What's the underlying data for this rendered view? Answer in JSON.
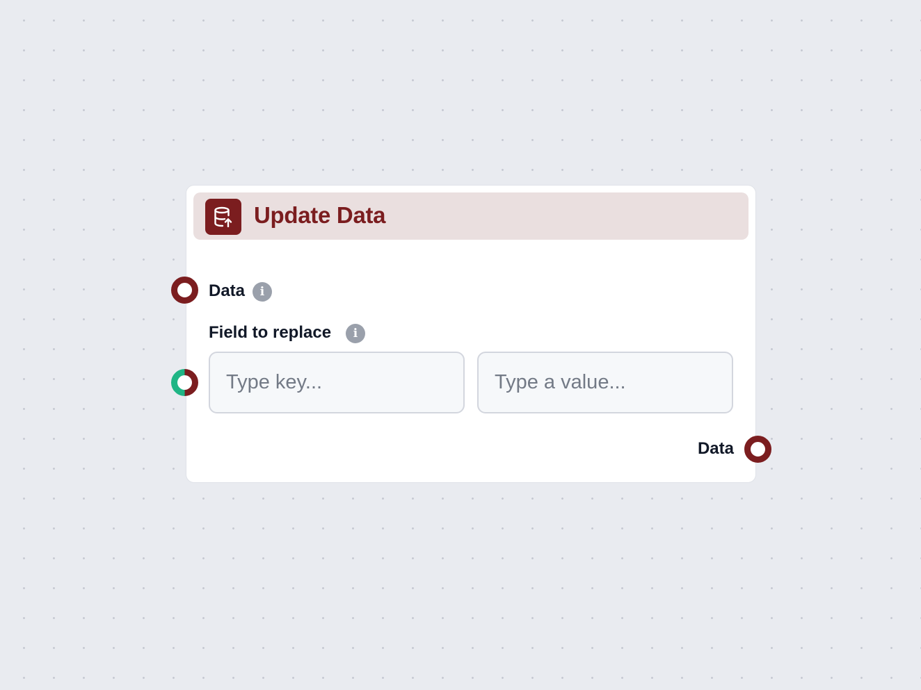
{
  "node": {
    "title": "Update Data",
    "icon": "database-upload-icon",
    "inputs": [
      {
        "label": "Data",
        "info_icon": "info-icon"
      }
    ],
    "field": {
      "label": "Field to replace",
      "info_icon": "info-icon",
      "key_placeholder": "Type key...",
      "value_placeholder": "Type a value..."
    },
    "outputs": [
      {
        "label": "Data"
      }
    ]
  },
  "colors": {
    "accent": "#7b1d1f",
    "header_bg": "#eadfdf",
    "handle_alt": "#1fb585",
    "canvas_bg": "#e9ebf0"
  }
}
